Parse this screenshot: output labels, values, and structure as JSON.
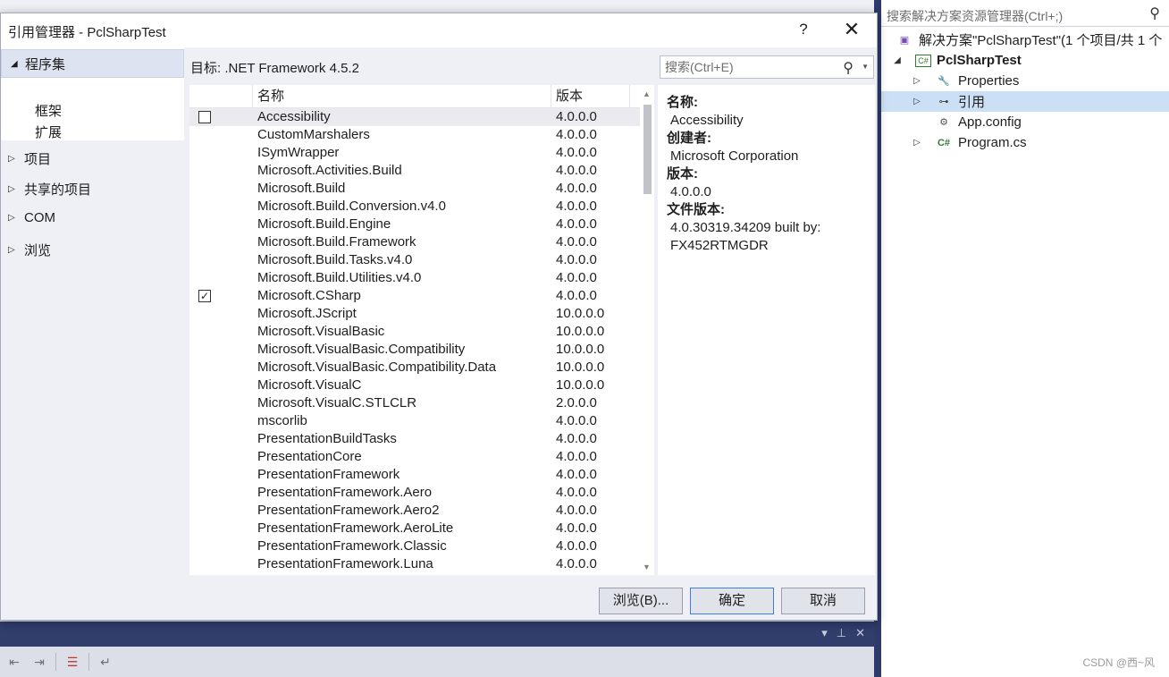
{
  "dialog": {
    "title": "引用管理器 - PclSharpTest",
    "help": "?",
    "close": "✕",
    "target_label": "目标: .NET Framework 4.5.2",
    "search_placeholder": "搜索(Ctrl+E)",
    "buttons": {
      "browse": "浏览(B)...",
      "ok": "确定",
      "cancel": "取消"
    }
  },
  "nav": {
    "assemblies": "程序集",
    "sub_framework": "框架",
    "sub_extensions": "扩展",
    "projects": "项目",
    "shared_projects": "共享的项目",
    "com": "COM",
    "browse": "浏览"
  },
  "list": {
    "columns": {
      "name": "名称",
      "version": "版本"
    },
    "rows": [
      {
        "name": "Accessibility",
        "version": "4.0.0.0",
        "checkbox_visible": true,
        "checked": false,
        "selected": true
      },
      {
        "name": "CustomMarshalers",
        "version": "4.0.0.0"
      },
      {
        "name": "ISymWrapper",
        "version": "4.0.0.0"
      },
      {
        "name": "Microsoft.Activities.Build",
        "version": "4.0.0.0"
      },
      {
        "name": "Microsoft.Build",
        "version": "4.0.0.0"
      },
      {
        "name": "Microsoft.Build.Conversion.v4.0",
        "version": "4.0.0.0"
      },
      {
        "name": "Microsoft.Build.Engine",
        "version": "4.0.0.0"
      },
      {
        "name": "Microsoft.Build.Framework",
        "version": "4.0.0.0"
      },
      {
        "name": "Microsoft.Build.Tasks.v4.0",
        "version": "4.0.0.0"
      },
      {
        "name": "Microsoft.Build.Utilities.v4.0",
        "version": "4.0.0.0"
      },
      {
        "name": "Microsoft.CSharp",
        "version": "4.0.0.0",
        "checkbox_visible": true,
        "checked": true
      },
      {
        "name": "Microsoft.JScript",
        "version": "10.0.0.0"
      },
      {
        "name": "Microsoft.VisualBasic",
        "version": "10.0.0.0"
      },
      {
        "name": "Microsoft.VisualBasic.Compatibility",
        "version": "10.0.0.0"
      },
      {
        "name": "Microsoft.VisualBasic.Compatibility.Data",
        "version": "10.0.0.0"
      },
      {
        "name": "Microsoft.VisualC",
        "version": "10.0.0.0"
      },
      {
        "name": "Microsoft.VisualC.STLCLR",
        "version": "2.0.0.0"
      },
      {
        "name": "mscorlib",
        "version": "4.0.0.0"
      },
      {
        "name": "PresentationBuildTasks",
        "version": "4.0.0.0"
      },
      {
        "name": "PresentationCore",
        "version": "4.0.0.0"
      },
      {
        "name": "PresentationFramework",
        "version": "4.0.0.0"
      },
      {
        "name": "PresentationFramework.Aero",
        "version": "4.0.0.0"
      },
      {
        "name": "PresentationFramework.Aero2",
        "version": "4.0.0.0"
      },
      {
        "name": "PresentationFramework.AeroLite",
        "version": "4.0.0.0"
      },
      {
        "name": "PresentationFramework.Classic",
        "version": "4.0.0.0"
      },
      {
        "name": "PresentationFramework.Luna",
        "version": "4.0.0.0"
      }
    ]
  },
  "details": {
    "name_label": "名称:",
    "name_value": "Accessibility",
    "creator_label": "创建者:",
    "creator_value": "Microsoft Corporation",
    "version_label": "版本:",
    "version_value": "4.0.0.0",
    "file_version_label": "文件版本:",
    "file_version_value_1": "4.0.30319.34209 built by:",
    "file_version_value_2": "FX452RTMGDR"
  },
  "solution_explorer": {
    "search_placeholder": "搜索解决方案资源管理器(Ctrl+;)",
    "solution": "解决方案\"PclSharpTest\"(1 个项目/共 1 个",
    "project": "PclSharpTest",
    "items": {
      "properties": "Properties",
      "references": "引用",
      "app_config": "App.config",
      "program": "Program.cs"
    }
  },
  "watermark": "CSDN @西~风",
  "colors": {
    "accent": "#3f80d6",
    "ide_frame": "#2f3a6a",
    "selection": "#cce0f5"
  }
}
